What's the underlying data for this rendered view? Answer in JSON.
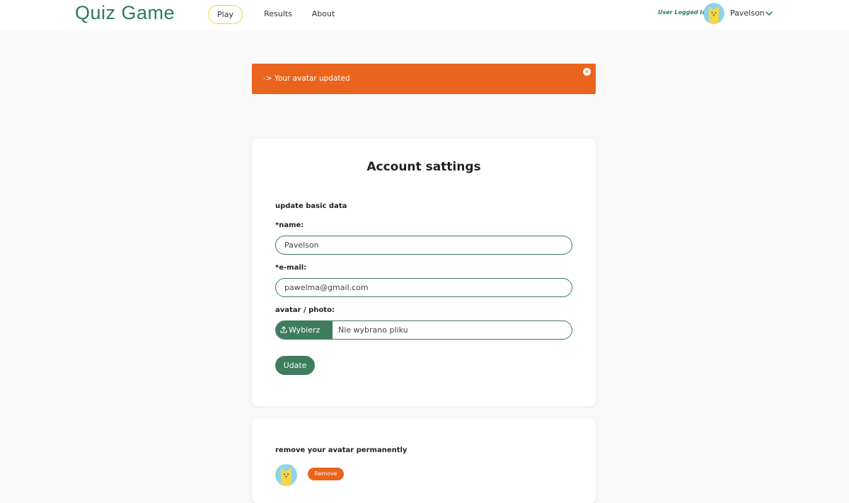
{
  "header": {
    "logo": "Quiz Game",
    "nav": {
      "play": "Play",
      "results": "Results",
      "about": "About"
    },
    "status": "User Logged In!",
    "username": "Pavelson",
    "menu_icon": "chevron-down-icon"
  },
  "alert": {
    "message": "-> Your avatar updated",
    "close_icon": "close-icon"
  },
  "account_settings": {
    "title": "Account sattings",
    "section": "update basic data",
    "name_label": "*name:",
    "name_value": "Pavelson",
    "email_label": "*e-mail:",
    "email_value": "pawelma@gmail.com",
    "avatar_label": "avatar / photo:",
    "file_button": "Wybierz plik",
    "file_status": "Nie wybrano pliku",
    "submit": "Udate"
  },
  "remove_avatar": {
    "section": "remove your avatar permanently",
    "button": "Remove"
  },
  "colors": {
    "brand_green": "#2f7a55",
    "button_green": "#3f7c5e",
    "accent_orange": "#ea641d",
    "play_border": "#e8d13a"
  }
}
